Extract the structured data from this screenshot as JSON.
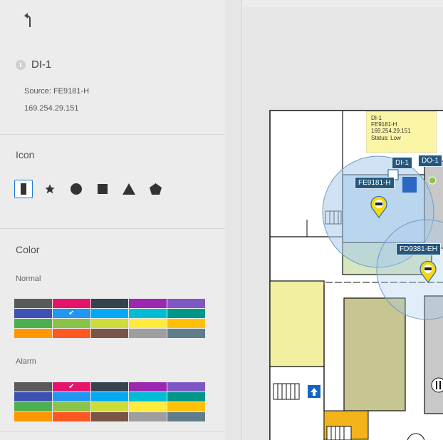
{
  "device": {
    "name": "DI-1",
    "source": "Source: FE9181-H",
    "ip": "169.254.29.151"
  },
  "icon_section": {
    "title": "Icon",
    "options": [
      "door-contact-icon",
      "star-icon",
      "circle-icon",
      "square-icon",
      "triangle-icon",
      "pentagon-icon"
    ],
    "selected": 0
  },
  "color_section": {
    "title": "Color",
    "normal_label": "Normal",
    "alarm_label": "Alarm",
    "palette": [
      "#5a5a5a",
      "#e5146b",
      "#37434c",
      "#9c27b0",
      "#7e57c2",
      "#3f51b5",
      "#2196f3",
      "#03a9f4",
      "#00bcd4",
      "#009688",
      "#4caf50",
      "#8bc34a",
      "#cddc39",
      "#ffeb3b",
      "#ffc107",
      "#ff9800",
      "#ff5722",
      "#795548",
      "#9e9e9e",
      "#607d8b"
    ],
    "normal_selected": 6,
    "alarm_selected": 1
  },
  "map": {
    "tooltip": {
      "line1": "DI-1",
      "line2": "FE9181-H",
      "line3": "169.254.29.151",
      "line4": "Status: Low"
    },
    "tags": {
      "di": "DI-1",
      "do": "DO-1",
      "camera1": "FE9181-H",
      "camera2": "FD9381-EH"
    }
  },
  "colors": {
    "tag_bg": "#22587e",
    "selected_border": "#1f7ad8",
    "tooltip_bg": "#fbf5a6"
  }
}
